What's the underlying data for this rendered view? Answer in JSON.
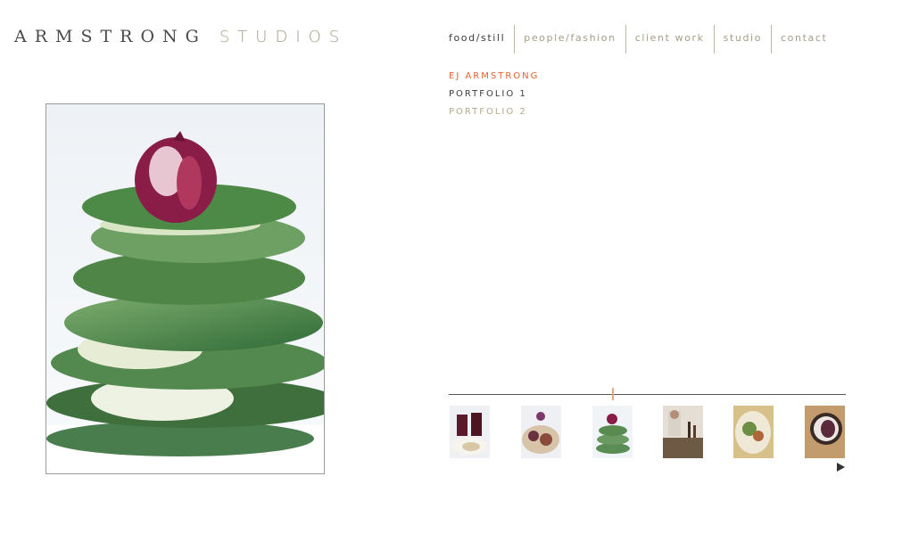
{
  "brand": {
    "first": "ARMSTRONG",
    "second": "STUDIOS"
  },
  "nav": [
    {
      "label": "food/still",
      "active": true
    },
    {
      "label": "people/fashion"
    },
    {
      "label": "client work"
    },
    {
      "label": "studio"
    },
    {
      "label": "contact"
    }
  ],
  "submenu": [
    {
      "label": "EJ ARMSTRONG",
      "state": "active"
    },
    {
      "label": "PORTFOLIO 1",
      "state": "dark"
    },
    {
      "label": "PORTFOLIO 2",
      "state": "muted"
    }
  ],
  "main_image": {
    "subject": "radicchio on stacked romaine lettuce"
  },
  "thumbnails": [
    {
      "subject": "wine glasses with cheese plate",
      "active": false
    },
    {
      "subject": "appetizer plate with grapes",
      "active": false
    },
    {
      "subject": "radicchio on lettuce",
      "active": true
    },
    {
      "subject": "chef at wine bar",
      "active": false
    },
    {
      "subject": "salad plate",
      "active": false
    },
    {
      "subject": "figs on plate",
      "active": false
    }
  ],
  "strip": {
    "next_icon": "play-right-icon"
  },
  "colors": {
    "accent": "#e2622c",
    "brand_muted": "#a79d85",
    "muted": "#b7a98a",
    "text": "#3c3c3c"
  }
}
